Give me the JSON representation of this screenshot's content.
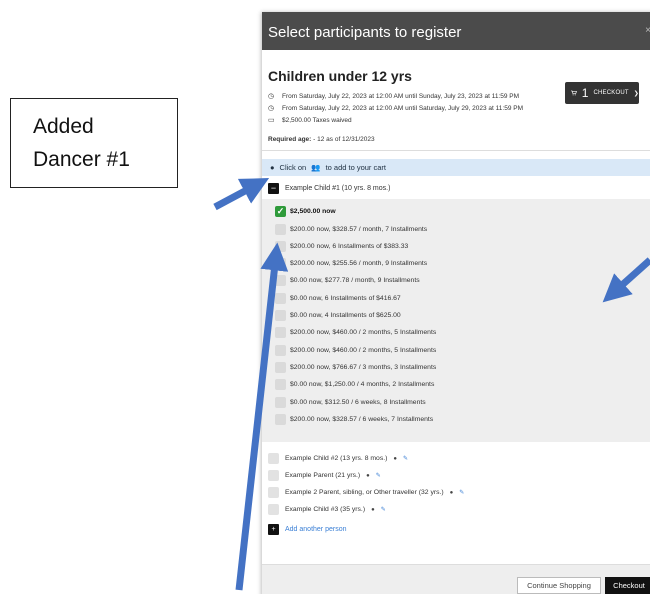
{
  "callout": {
    "line1": "Added",
    "line2": "Dancer #1"
  },
  "modal": {
    "title": "Select participants to register",
    "close": "×",
    "program_title": "Children under 12 yrs",
    "cart": {
      "icon": "cart-icon",
      "count": "1",
      "label": "CHECKOUT"
    },
    "info": [
      {
        "icon": "clock-icon",
        "text": "From Saturday, July 22, 2023 at 12:00 AM until Sunday, July 23, 2023 at 11:59 PM"
      },
      {
        "icon": "clock-icon",
        "text": "From Saturday, July 22, 2023 at 12:00 AM until Saturday, July 29, 2023 at 11:59 PM"
      },
      {
        "icon": "money-icon",
        "text": "$2,500.00 Taxes waived"
      }
    ],
    "required_age_label": "Required age:",
    "required_age_value": " - 12 as of 12/31/2023",
    "hint": {
      "prefix": "Click on",
      "suffix": "to add to your cart"
    },
    "child1": "Example Child #1 (10 yrs. 8 mos.)",
    "options": [
      "$2,500.00 now",
      "$200.00 now, $328.57 / month, 7 Installments",
      "$200.00 now, 6 Installments of $383.33",
      "$200.00 now, $255.56 / month, 9 Installments",
      "$0.00 now, $277.78 / month, 9 Installments",
      "$0.00 now, 6 Installments of $416.67",
      "$0.00 now, 4 Installments of $625.00",
      "$200.00 now, $460.00 / 2 months, 5 Installments",
      "$200.00 now, $460.00 / 2 months, 5 Installments",
      "$200.00 now, $766.67 / 3 months, 3 Installments",
      "$0.00 now, $1,250.00 / 4 months, 2 Installments",
      "$0.00 now, $312.50 / 6 weeks, 8 Installments",
      "$200.00 now, $328.57 / 6 weeks, 7 Installments"
    ],
    "selected_option_index": 0,
    "people": [
      "Example Child #2 (13 yrs. 8 mos.)",
      "Example Parent (21 yrs.)",
      "Example 2 Parent, sibling, or Other traveller (32 yrs.)",
      "Example Child #3 (35 yrs.)"
    ],
    "add_person": "Add another person",
    "continue_label": "Continue Shopping",
    "checkout_label": "Checkout"
  },
  "colors": {
    "header_bg": "#4b4b4b",
    "hint_bg": "#d9e8f7",
    "selected_check": "#2e9a3a",
    "arrow": "#4472c4",
    "link": "#3a7fd5"
  }
}
